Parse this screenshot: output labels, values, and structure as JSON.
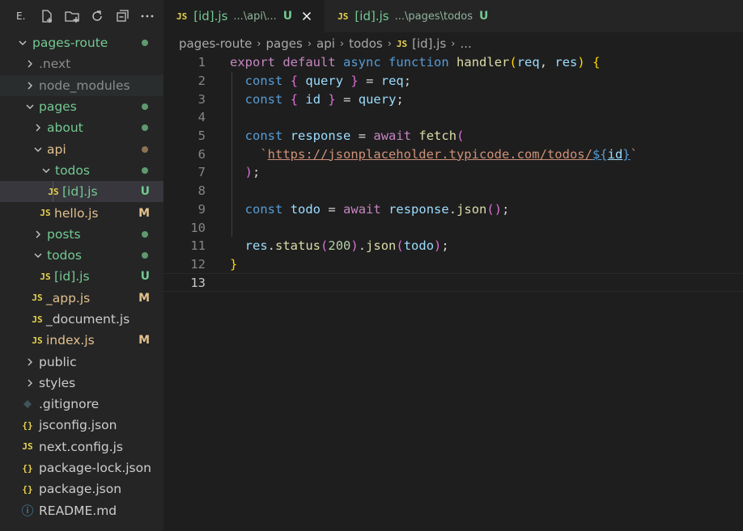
{
  "explorer": {
    "title_abbrev": "E.",
    "toolbar_icons": [
      "new-file-icon",
      "new-folder-icon",
      "refresh-icon",
      "collapse-all-icon",
      "more-icon"
    ],
    "root": "pages-route",
    "items": [
      {
        "label": ".next",
        "kind": "folder",
        "depth": 1,
        "expanded": false
      },
      {
        "label": "node_modules",
        "kind": "folder",
        "depth": 1,
        "expanded": false
      },
      {
        "label": "pages",
        "kind": "folder",
        "depth": 1,
        "expanded": true
      },
      {
        "label": "about",
        "kind": "folder",
        "depth": 2,
        "expanded": false
      },
      {
        "label": "api",
        "kind": "folder",
        "depth": 2,
        "expanded": true
      },
      {
        "label": "todos",
        "kind": "folder",
        "depth": 3,
        "expanded": true
      },
      {
        "label": "[id].js",
        "kind": "js",
        "depth": 4,
        "badge": "U"
      },
      {
        "label": "hello.js",
        "kind": "js",
        "depth": 3,
        "badge": "M"
      },
      {
        "label": "posts",
        "kind": "folder",
        "depth": 2,
        "expanded": false
      },
      {
        "label": "todos",
        "kind": "folder",
        "depth": 2,
        "expanded": true
      },
      {
        "label": "[id].js",
        "kind": "js",
        "depth": 3,
        "badge": "U"
      },
      {
        "label": "_app.js",
        "kind": "js",
        "depth": 2,
        "badge": "M"
      },
      {
        "label": "_document.js",
        "kind": "js",
        "depth": 2
      },
      {
        "label": "index.js",
        "kind": "js",
        "depth": 2,
        "badge": "M"
      },
      {
        "label": "public",
        "kind": "folder",
        "depth": 1,
        "expanded": false
      },
      {
        "label": "styles",
        "kind": "folder",
        "depth": 1,
        "expanded": false
      },
      {
        "label": ".gitignore",
        "kind": "git",
        "depth": 1
      },
      {
        "label": "jsconfig.json",
        "kind": "json",
        "depth": 1
      },
      {
        "label": "next.config.js",
        "kind": "js",
        "depth": 1
      },
      {
        "label": "package-lock.json",
        "kind": "json",
        "depth": 1
      },
      {
        "label": "package.json",
        "kind": "json",
        "depth": 1
      },
      {
        "label": "README.md",
        "kind": "info",
        "depth": 1
      }
    ],
    "icon_glyphs": {
      "js": "JS",
      "json": "{}",
      "info": "ⓘ"
    }
  },
  "tabs": [
    {
      "icon": "JS",
      "name": "[id].js",
      "desc": "...\\api\\...",
      "status": "U",
      "active": true
    },
    {
      "icon": "JS",
      "name": "[id].js",
      "desc": "...\\pages\\todos",
      "status": "U",
      "active": false
    }
  ],
  "breadcrumb": {
    "parts": [
      "pages-route",
      "pages",
      "api",
      "todos"
    ],
    "file_icon": "JS",
    "file": "[id].js",
    "tail": "..."
  },
  "editor": {
    "line_numbers": [
      "1",
      "2",
      "3",
      "4",
      "5",
      "6",
      "7",
      "8",
      "9",
      "10",
      "11",
      "12",
      "13"
    ],
    "current_line": 13
  },
  "colors": {
    "git_added": "#73c991",
    "git_modified": "#e2c08d",
    "js_icon": "#e8d44d",
    "json_icon": "#e8d44d",
    "selection": "#37373d"
  }
}
